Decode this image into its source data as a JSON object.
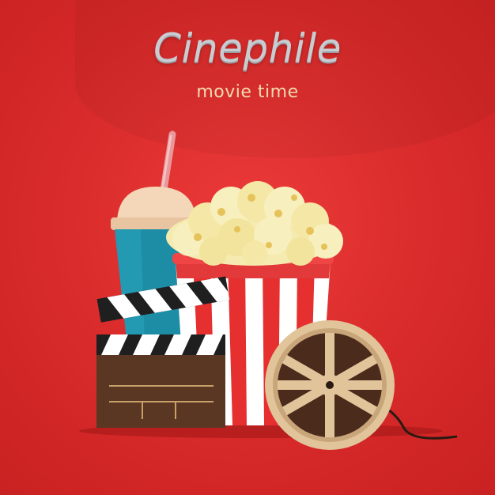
{
  "poster": {
    "title": "Cinephile",
    "subtitle": "movie time"
  },
  "illustration": {
    "items": [
      "soda-cup",
      "popcorn-bucket",
      "clapperboard",
      "film-reel"
    ],
    "colors": {
      "background": "#d82a2a",
      "cup": "#1e8fa6",
      "popcorn": "#f5eab0",
      "bucket_stripe": "#e02a2a",
      "clapper_board": "#5a3722",
      "reel": "#e2c49a"
    }
  }
}
